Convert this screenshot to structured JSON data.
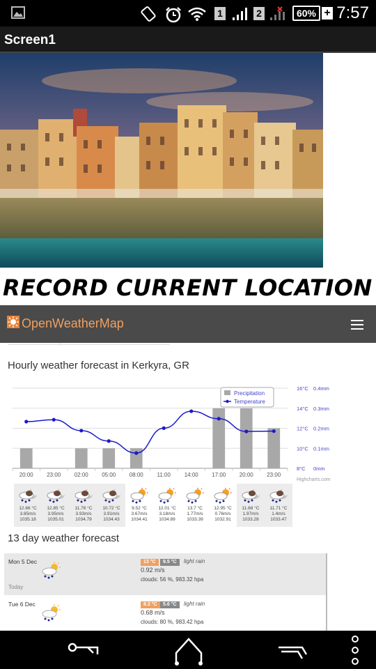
{
  "status_bar": {
    "time": "7:57",
    "battery": "60%",
    "sim1": "1",
    "sim2": "2"
  },
  "app": {
    "title": "Screen1"
  },
  "main": {
    "record_label": "RECORD CURRENT LOCATION"
  },
  "owm": {
    "brand": "OpenWeatherMap",
    "hourly_title": "Hourly weather forecast in Kerkyra, GR",
    "daily_title": "13 day weather forecast",
    "credit": "Highcharts.com"
  },
  "chart_data": {
    "type": "bar",
    "categories": [
      "20:00",
      "23:00",
      "02:00",
      "05:00",
      "08:00",
      "11:00",
      "14:00",
      "17:00",
      "20:00",
      "23:00"
    ],
    "series": [
      {
        "name": "Precipitation",
        "type": "bar",
        "axis": "right",
        "values": [
          0.1,
          0,
          0.1,
          0.1,
          0.1,
          0,
          0,
          0.3,
          0.3,
          0.2
        ]
      },
      {
        "name": "Temperature",
        "type": "line",
        "axis": "left",
        "values": [
          12.66,
          12.85,
          11.76,
          10.72,
          9.52,
          12.01,
          13.7,
          12.95,
          11.68,
          11.71
        ]
      }
    ],
    "y_left_ticks": [
      "16°C",
      "14°C",
      "12°C",
      "10°C",
      "8°C"
    ],
    "y_left_range": [
      8,
      16
    ],
    "y_right_ticks": [
      "0.4mm",
      "0.3mm",
      "0.2mm",
      "0.1mm",
      "0mm"
    ],
    "y_right_range": [
      0,
      0.4
    ],
    "legend": {
      "placement": "top-right",
      "entries": [
        "Precipitation",
        "Temperature"
      ]
    },
    "colors": {
      "precipitation": "#a8a8a8",
      "temperature": "#1a1acc"
    }
  },
  "hourly_icons": [
    {
      "temp": "12.66 °C",
      "wind": "3.85m/s",
      "pressure": "1035.18",
      "icon": "cloud-rain-night-icon"
    },
    {
      "temp": "12.85 °C",
      "wind": "3.95m/s",
      "pressure": "1035.01",
      "icon": "cloud-rain-night-icon"
    },
    {
      "temp": "11.76 °C",
      "wind": "3.93m/s",
      "pressure": "1034.79",
      "icon": "cloud-rain-night-icon"
    },
    {
      "temp": "10.72 °C",
      "wind": "3.91m/s",
      "pressure": "1034.43",
      "icon": "cloud-rain-night-icon"
    },
    {
      "temp": "9.52 °C",
      "wind": "3.67m/s",
      "pressure": "1034.41",
      "icon": "sun-rain-icon"
    },
    {
      "temp": "12.01 °C",
      "wind": "3.18m/s",
      "pressure": "1034.89",
      "icon": "sun-rain-icon"
    },
    {
      "temp": "13.7 °C",
      "wind": "1.77m/s",
      "pressure": "1033.39",
      "icon": "sun-rain-icon"
    },
    {
      "temp": "12.95 °C",
      "wind": "0.76m/s",
      "pressure": "1032.91",
      "icon": "sun-rain-icon"
    },
    {
      "temp": "11.68 °C",
      "wind": "1.97m/s",
      "pressure": "1033.28",
      "icon": "cloud-rain-night-icon"
    },
    {
      "temp": "11.71 °C",
      "wind": "1.4m/s",
      "pressure": "1033.47",
      "icon": "cloud-rain-night-icon"
    }
  ],
  "daily": [
    {
      "day": "Mon 5 Dec",
      "sub": "Today",
      "hi": "13 °C",
      "lo": "9.5 °C",
      "desc": "light rain",
      "wind": "0.92 m/s",
      "clouds": "clouds: 56 %, 983.32 hpa"
    },
    {
      "day": "Tue 6 Dec",
      "sub": "",
      "hi": "8.3 °C",
      "lo": "5.6 °C",
      "desc": "light rain",
      "wind": "0.68 m/s",
      "clouds": "clouds: 80 %, 983.42 hpa"
    }
  ]
}
